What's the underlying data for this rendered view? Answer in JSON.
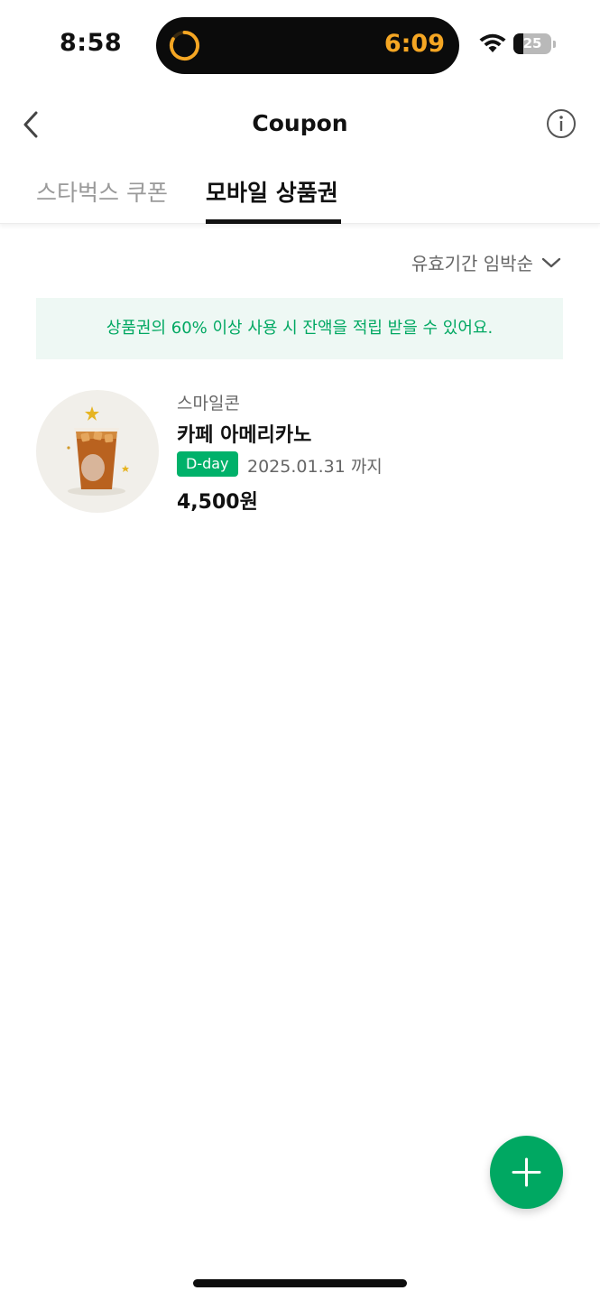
{
  "status_bar": {
    "time": "8:58",
    "timer": "6:09",
    "battery_level": "25",
    "battery_fraction": 0.25
  },
  "nav": {
    "title": "Coupon",
    "back_icon": "chevron-left-icon",
    "info_icon": "info-circle-icon"
  },
  "tabs": [
    {
      "label": "스타벅스 쿠폰",
      "active": false
    },
    {
      "label": "모바일 상품권",
      "active": true
    }
  ],
  "sort": {
    "label": "유효기간 임박순",
    "icon": "chevron-down-icon"
  },
  "notice": {
    "text": "상품권의 60% 이상 사용 시 잔액을 적립 받을 수 있어요."
  },
  "vouchers": [
    {
      "brand": "스마일콘",
      "product": "카페 아메리카노",
      "badge": "D-day",
      "expiry": "2025.01.31 까지",
      "price": "4,500원"
    }
  ],
  "fab": {
    "icon": "plus-icon"
  },
  "colors": {
    "accent": "#00a862",
    "badge": "#00b16a",
    "notice_bg": "#eef8f4",
    "timer": "#f5a623"
  }
}
